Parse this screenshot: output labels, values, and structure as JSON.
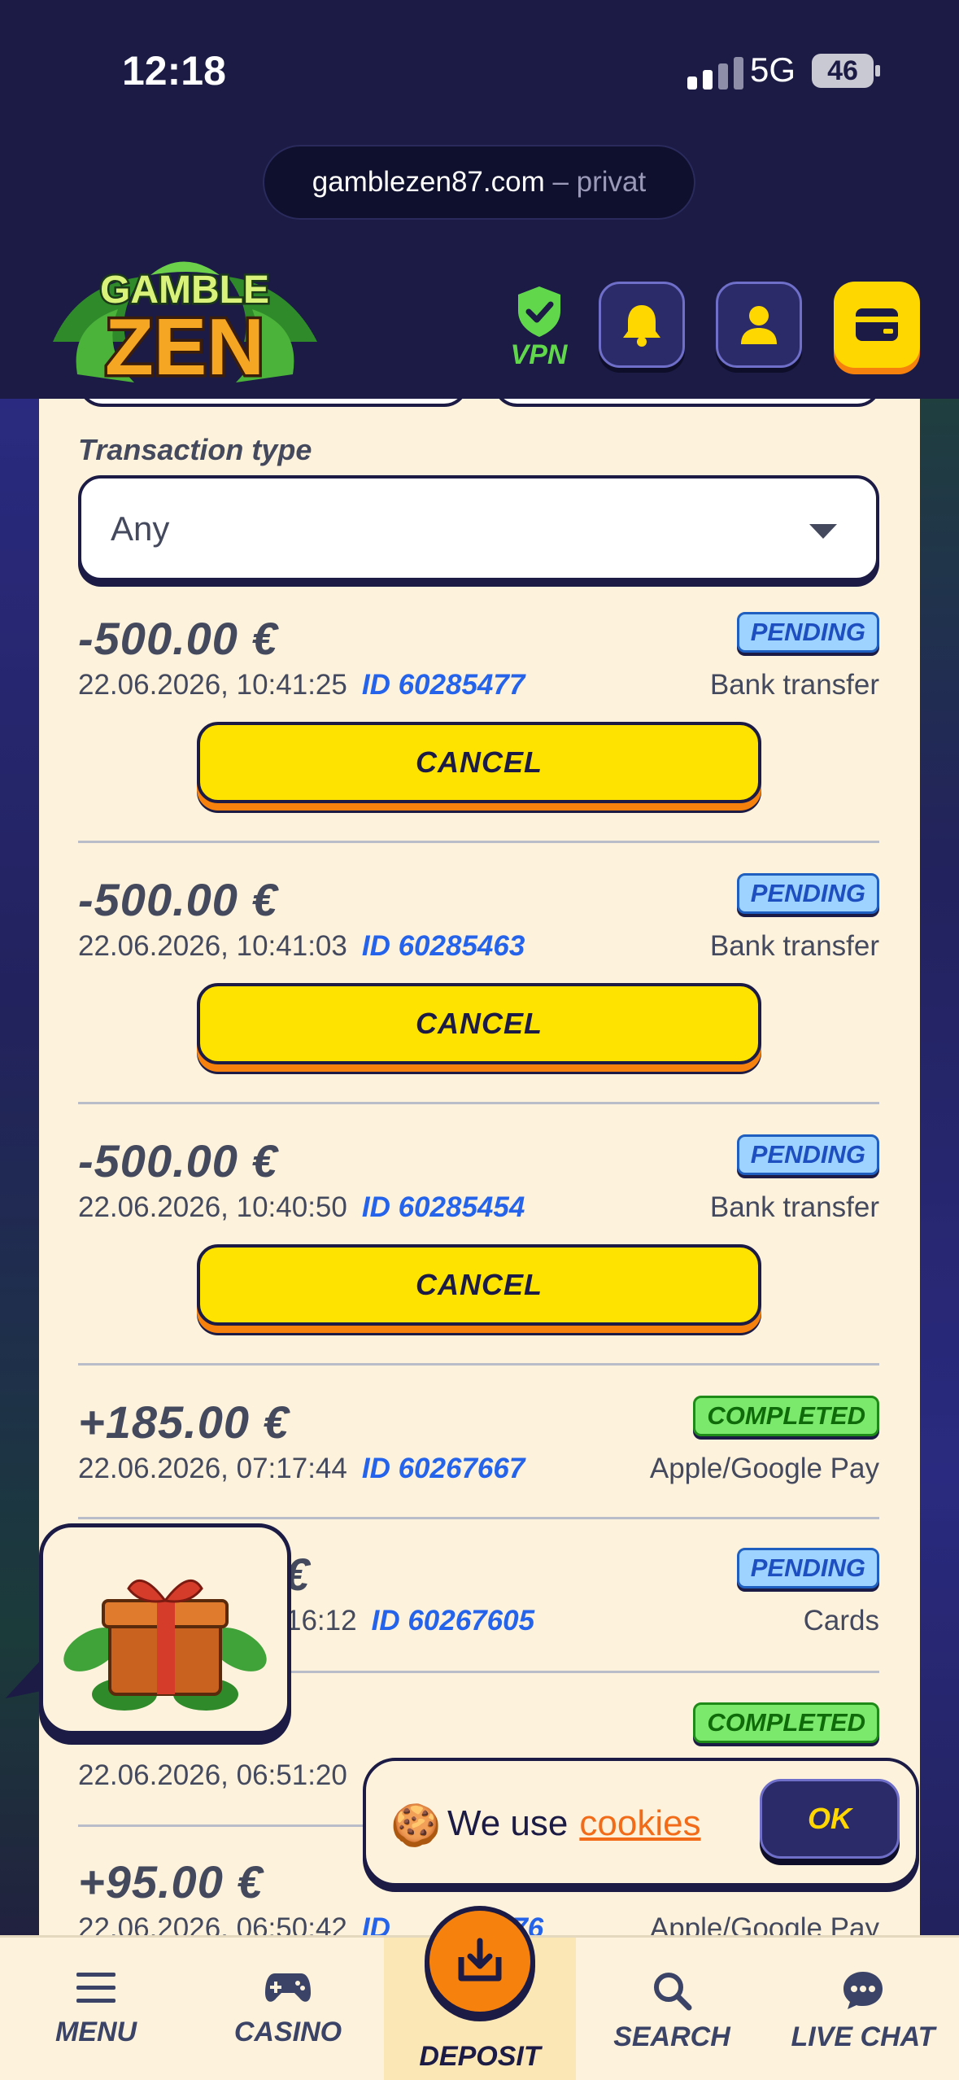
{
  "status_bar": {
    "time": "12:18",
    "network": "5G",
    "battery": "46"
  },
  "browser": {
    "url": "gamblezen87.com",
    "mode": "– privat"
  },
  "header": {
    "logo_top": "GAMBLE",
    "logo_bottom": "ZEN",
    "vpn_label": "VPN"
  },
  "filter": {
    "label": "Transaction type",
    "value": "Any"
  },
  "transactions": [
    {
      "amount": "-500.00 €",
      "datetime": "22.06.2026, 10:41:25",
      "id": "ID 60285477",
      "method": "Bank transfer",
      "status": "PENDING",
      "action": "CANCEL"
    },
    {
      "amount": "-500.00 €",
      "datetime": "22.06.2026, 10:41:03",
      "id": "ID 60285463",
      "method": "Bank transfer",
      "status": "PENDING",
      "action": "CANCEL"
    },
    {
      "amount": "-500.00 €",
      "datetime": "22.06.2026, 10:40:50",
      "id": "ID 60285454",
      "method": "Bank transfer",
      "status": "PENDING",
      "action": "CANCEL"
    },
    {
      "amount": "+185.00 €",
      "datetime": "22.06.2026, 07:17:44",
      "id": "ID 60267667",
      "method": "Apple/Google Pay",
      "status": "COMPLETED"
    },
    {
      "amount_visible": "€",
      "datetime_visible": "16:12",
      "id": "ID 60267605",
      "method": "Cards",
      "status": "PENDING"
    },
    {
      "datetime": "22.06.2026, 06:51:20",
      "status": "COMPLETED"
    },
    {
      "amount": "+95.00 €",
      "datetime": "22.06.2026, 06:50:42",
      "id_visible": "ID",
      "id_tail": "676",
      "method": "Apple/Google Pay"
    }
  ],
  "cookie_banner": {
    "icon": "🍪",
    "text": "We use",
    "link": "cookies",
    "button": "OK"
  },
  "nav": {
    "menu": "MENU",
    "casino": "CASINO",
    "deposit": "DEPOSIT",
    "search": "SEARCH",
    "live_chat": "LIVE CHAT"
  },
  "colors": {
    "header_bg": "#1b1b45",
    "panel_bg": "#fdf3dc",
    "accent_yellow": "#ffe300",
    "accent_orange": "#f6820d",
    "id_blue": "#2563eb",
    "pending_bg": "#9fd3ff",
    "completed_bg": "#7bea6c",
    "vpn_green": "#61d74c"
  }
}
